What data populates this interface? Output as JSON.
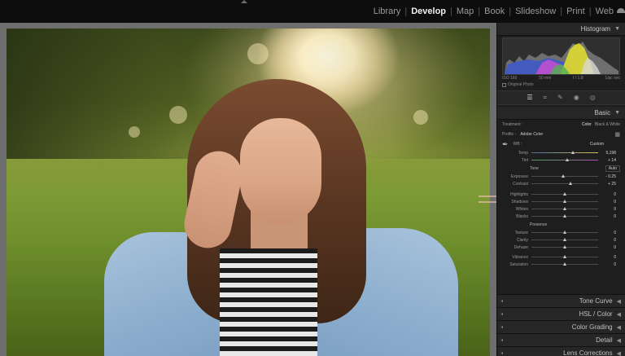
{
  "modules": {
    "items": [
      "Library",
      "Develop",
      "Map",
      "Book",
      "Slideshow",
      "Print",
      "Web"
    ],
    "active": "Develop"
  },
  "histogram": {
    "title": "Histogram",
    "info": [
      "ISO 160",
      "50 mm",
      "f / 1.8",
      "1/pc sec"
    ],
    "original_photo": "Original Photo"
  },
  "basic": {
    "title": "Basic",
    "treatment_label": "Treatment :",
    "treatment_options": [
      "Color",
      "Black & White"
    ],
    "treatment_selected": "Color",
    "profile_label": "Profile :",
    "profile_value": "Adobe Color",
    "wb_label": "WB :",
    "wb_value": "Custom",
    "sliders_wb": [
      {
        "label": "Temp",
        "value": "5,198",
        "pos": 0.62
      },
      {
        "label": "Tint",
        "value": "+ 14",
        "pos": 0.54
      }
    ],
    "tone_label": "Tone",
    "auto_label": "Auto",
    "sliders_tone": [
      {
        "label": "Exposure",
        "value": "- 0.25",
        "pos": 0.47
      },
      {
        "label": "Contrast",
        "value": "+ 25",
        "pos": 0.58
      }
    ],
    "sliders_tone2": [
      {
        "label": "Highlights",
        "value": "0",
        "pos": 0.5
      },
      {
        "label": "Shadows",
        "value": "0",
        "pos": 0.5
      },
      {
        "label": "Whites",
        "value": "0",
        "pos": 0.5
      },
      {
        "label": "Blacks",
        "value": "0",
        "pos": 0.5
      }
    ],
    "presence_label": "Presence",
    "sliders_presence": [
      {
        "label": "Texture",
        "value": "0",
        "pos": 0.5
      },
      {
        "label": "Clarity",
        "value": "0",
        "pos": 0.5
      },
      {
        "label": "Dehaze",
        "value": "0",
        "pos": 0.5
      }
    ],
    "sliders_color": [
      {
        "label": "Vibrance",
        "value": "0",
        "pos": 0.5
      },
      {
        "label": "Saturation",
        "value": "0",
        "pos": 0.5
      }
    ]
  },
  "sections": [
    "Tone Curve",
    "HSL / Color",
    "Color Grading",
    "Detail",
    "Lens Corrections"
  ],
  "colors": {
    "panel_bg": "#1e1e1e",
    "topbar_bg": "#0d0d0d",
    "active_module": "#f0f0f0"
  }
}
